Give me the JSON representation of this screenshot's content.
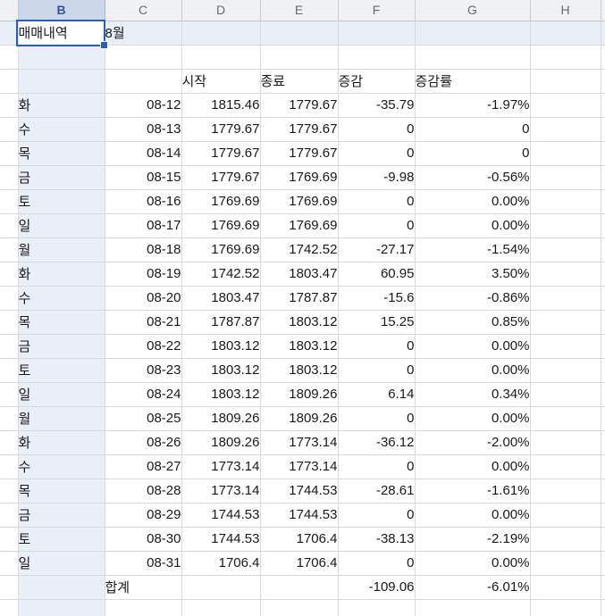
{
  "sheet": {
    "column_headers": [
      "B",
      "C",
      "D",
      "E",
      "F",
      "G",
      "H"
    ],
    "selected_column": "B",
    "selected_cell": "B1",
    "title_cell": "매매내역",
    "month_cell": "8월",
    "table_headers": {
      "start": "시작",
      "end": "종료",
      "change": "증감",
      "rate": "증감률"
    },
    "rows": [
      {
        "day": "화",
        "date": "08-12",
        "start": "1815.46",
        "end": "1779.67",
        "change": "-35.79",
        "rate": "-1.97%"
      },
      {
        "day": "수",
        "date": "08-13",
        "start": "1779.67",
        "end": "1779.67",
        "change": "0",
        "rate": "0"
      },
      {
        "day": "목",
        "date": "08-14",
        "start": "1779.67",
        "end": "1779.67",
        "change": "0",
        "rate": "0"
      },
      {
        "day": "금",
        "date": "08-15",
        "start": "1779.67",
        "end": "1769.69",
        "change": "-9.98",
        "rate": "-0.56%"
      },
      {
        "day": "토",
        "date": "08-16",
        "start": "1769.69",
        "end": "1769.69",
        "change": "0",
        "rate": "0.00%"
      },
      {
        "day": "일",
        "date": "08-17",
        "start": "1769.69",
        "end": "1769.69",
        "change": "0",
        "rate": "0.00%"
      },
      {
        "day": "월",
        "date": "08-18",
        "start": "1769.69",
        "end": "1742.52",
        "change": "-27.17",
        "rate": "-1.54%"
      },
      {
        "day": "화",
        "date": "08-19",
        "start": "1742.52",
        "end": "1803.47",
        "change": "60.95",
        "rate": "3.50%"
      },
      {
        "day": "수",
        "date": "08-20",
        "start": "1803.47",
        "end": "1787.87",
        "change": "-15.6",
        "rate": "-0.86%"
      },
      {
        "day": "목",
        "date": "08-21",
        "start": "1787.87",
        "end": "1803.12",
        "change": "15.25",
        "rate": "0.85%"
      },
      {
        "day": "금",
        "date": "08-22",
        "start": "1803.12",
        "end": "1803.12",
        "change": "0",
        "rate": "0.00%"
      },
      {
        "day": "토",
        "date": "08-23",
        "start": "1803.12",
        "end": "1803.12",
        "change": "0",
        "rate": "0.00%"
      },
      {
        "day": "일",
        "date": "08-24",
        "start": "1803.12",
        "end": "1809.26",
        "change": "6.14",
        "rate": "0.34%"
      },
      {
        "day": "월",
        "date": "08-25",
        "start": "1809.26",
        "end": "1809.26",
        "change": "0",
        "rate": "0.00%"
      },
      {
        "day": "화",
        "date": "08-26",
        "start": "1809.26",
        "end": "1773.14",
        "change": "-36.12",
        "rate": "-2.00%"
      },
      {
        "day": "수",
        "date": "08-27",
        "start": "1773.14",
        "end": "1773.14",
        "change": "0",
        "rate": "0.00%"
      },
      {
        "day": "목",
        "date": "08-28",
        "start": "1773.14",
        "end": "1744.53",
        "change": "-28.61",
        "rate": "-1.61%"
      },
      {
        "day": "금",
        "date": "08-29",
        "start": "1744.53",
        "end": "1744.53",
        "change": "0",
        "rate": "0.00%"
      },
      {
        "day": "토",
        "date": "08-30",
        "start": "1744.53",
        "end": "1706.4",
        "change": "-38.13",
        "rate": "-2.19%"
      },
      {
        "day": "일",
        "date": "08-31",
        "start": "1706.4",
        "end": "1706.4",
        "change": "0",
        "rate": "0.00%"
      }
    ],
    "total": {
      "label": "합계",
      "change": "-109.06",
      "rate": "-6.01%"
    },
    "colors": {
      "selection_border": "#2a5dc0",
      "cell_fill": "#e9eef7",
      "selected_header_fill": "#ccd7ea",
      "selected_header_text": "#2a579e",
      "header_fill": "#eff1f3",
      "gridline": "#d8dbde"
    }
  }
}
